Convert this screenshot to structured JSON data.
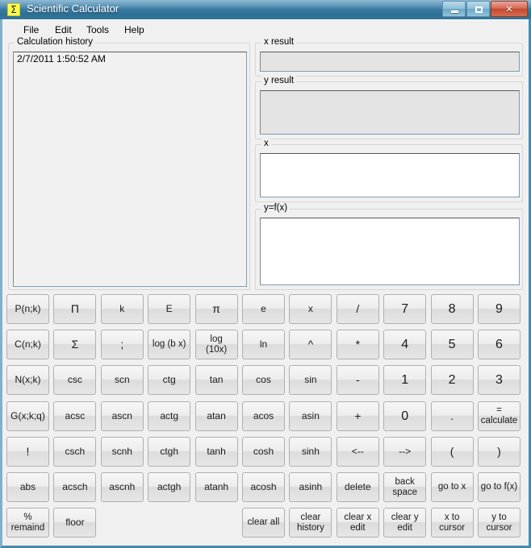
{
  "window": {
    "title": "Scientific Calculator",
    "icon": "sigma-icon",
    "icon_glyph": "Σ",
    "controls": {
      "minimize": "minimize-button",
      "maximize": "maximize-button",
      "close": "close-button",
      "close_glyph": "✕"
    },
    "titlebar_color": "#2f7095",
    "close_color": "#c24a30"
  },
  "menu": {
    "items": [
      {
        "label": "File"
      },
      {
        "label": "Edit"
      },
      {
        "label": "Tools"
      },
      {
        "label": "Help"
      }
    ]
  },
  "history": {
    "title": "Calculation history",
    "entries": [
      "2/7/2011 1:50:52 AM"
    ]
  },
  "fields": {
    "x_result": {
      "title": "x result",
      "value": "",
      "readonly": true
    },
    "y_result": {
      "title": "y result",
      "value": "",
      "readonly": true
    },
    "x": {
      "title": "x",
      "value": "",
      "readonly": false
    },
    "y_fx": {
      "title": "y=f(x)",
      "value": "",
      "readonly": false
    }
  },
  "keypad": {
    "rows": [
      [
        {
          "label": "P(n;k)",
          "kind": "fn"
        },
        {
          "label": "Π",
          "kind": "sym"
        },
        {
          "label": "k",
          "kind": "fn"
        },
        {
          "label": "E",
          "kind": "fn"
        },
        {
          "label": "π",
          "kind": "sym"
        },
        {
          "label": "e",
          "kind": "fn"
        },
        {
          "label": "x",
          "kind": "fn"
        },
        {
          "label": "/",
          "kind": "sym"
        },
        {
          "label": "7",
          "kind": "num"
        },
        {
          "label": "8",
          "kind": "num"
        },
        {
          "label": "9",
          "kind": "num"
        }
      ],
      [
        {
          "label": "C(n;k)",
          "kind": "fn"
        },
        {
          "label": "Σ",
          "kind": "sym"
        },
        {
          "label": ";",
          "kind": "sym"
        },
        {
          "label": "log (b x)",
          "kind": "two"
        },
        {
          "label": "log\n(10x)",
          "kind": "two"
        },
        {
          "label": "ln",
          "kind": "fn"
        },
        {
          "label": "^",
          "kind": "sym"
        },
        {
          "label": "*",
          "kind": "sym"
        },
        {
          "label": "4",
          "kind": "num"
        },
        {
          "label": "5",
          "kind": "num"
        },
        {
          "label": "6",
          "kind": "num"
        }
      ],
      [
        {
          "label": "N(x;k)",
          "kind": "fn"
        },
        {
          "label": "csc",
          "kind": "fn"
        },
        {
          "label": "scn",
          "kind": "fn"
        },
        {
          "label": "ctg",
          "kind": "fn"
        },
        {
          "label": "tan",
          "kind": "fn"
        },
        {
          "label": "cos",
          "kind": "fn"
        },
        {
          "label": "sin",
          "kind": "fn"
        },
        {
          "label": "-",
          "kind": "sym"
        },
        {
          "label": "1",
          "kind": "num"
        },
        {
          "label": "2",
          "kind": "num"
        },
        {
          "label": "3",
          "kind": "num"
        }
      ],
      [
        {
          "label": "G(x;k;q)",
          "kind": "fn"
        },
        {
          "label": "acsc",
          "kind": "fn"
        },
        {
          "label": "ascn",
          "kind": "fn"
        },
        {
          "label": "actg",
          "kind": "fn"
        },
        {
          "label": "atan",
          "kind": "fn"
        },
        {
          "label": "acos",
          "kind": "fn"
        },
        {
          "label": "asin",
          "kind": "fn"
        },
        {
          "label": "+",
          "kind": "sym"
        },
        {
          "label": "0",
          "kind": "num"
        },
        {
          "label": ".",
          "kind": "sym"
        },
        {
          "label": "=\ncalculate",
          "kind": "two"
        }
      ],
      [
        {
          "label": "!",
          "kind": "sym"
        },
        {
          "label": "csch",
          "kind": "fn"
        },
        {
          "label": "scnh",
          "kind": "fn"
        },
        {
          "label": "ctgh",
          "kind": "fn"
        },
        {
          "label": "tanh",
          "kind": "fn"
        },
        {
          "label": "cosh",
          "kind": "fn"
        },
        {
          "label": "sinh",
          "kind": "fn"
        },
        {
          "label": "<--",
          "kind": "fn"
        },
        {
          "label": "-->",
          "kind": "fn"
        },
        {
          "label": "(",
          "kind": "sym"
        },
        {
          "label": ")",
          "kind": "sym"
        }
      ],
      [
        {
          "label": "abs",
          "kind": "fn"
        },
        {
          "label": "acsch",
          "kind": "fn"
        },
        {
          "label": "ascnh",
          "kind": "fn"
        },
        {
          "label": "actgh",
          "kind": "fn"
        },
        {
          "label": "atanh",
          "kind": "fn"
        },
        {
          "label": "acosh",
          "kind": "fn"
        },
        {
          "label": "asinh",
          "kind": "fn"
        },
        {
          "label": "delete",
          "kind": "fn"
        },
        {
          "label": "back\nspace",
          "kind": "two"
        },
        {
          "label": "go to x",
          "kind": "two"
        },
        {
          "label": "go to f(x)",
          "kind": "two"
        }
      ],
      [
        {
          "label": "%\nremaind",
          "kind": "two"
        },
        {
          "label": "floor",
          "kind": "fn"
        },
        {
          "label": "",
          "kind": "empty"
        },
        {
          "label": "",
          "kind": "empty"
        },
        {
          "label": "",
          "kind": "empty"
        },
        {
          "label": "clear all",
          "kind": "two"
        },
        {
          "label": "clear\nhistory",
          "kind": "two"
        },
        {
          "label": "clear x\nedit",
          "kind": "two"
        },
        {
          "label": "clear y\nedit",
          "kind": "two"
        },
        {
          "label": "x to\ncursor",
          "kind": "two"
        },
        {
          "label": "y  to\ncursor",
          "kind": "two"
        }
      ]
    ]
  }
}
